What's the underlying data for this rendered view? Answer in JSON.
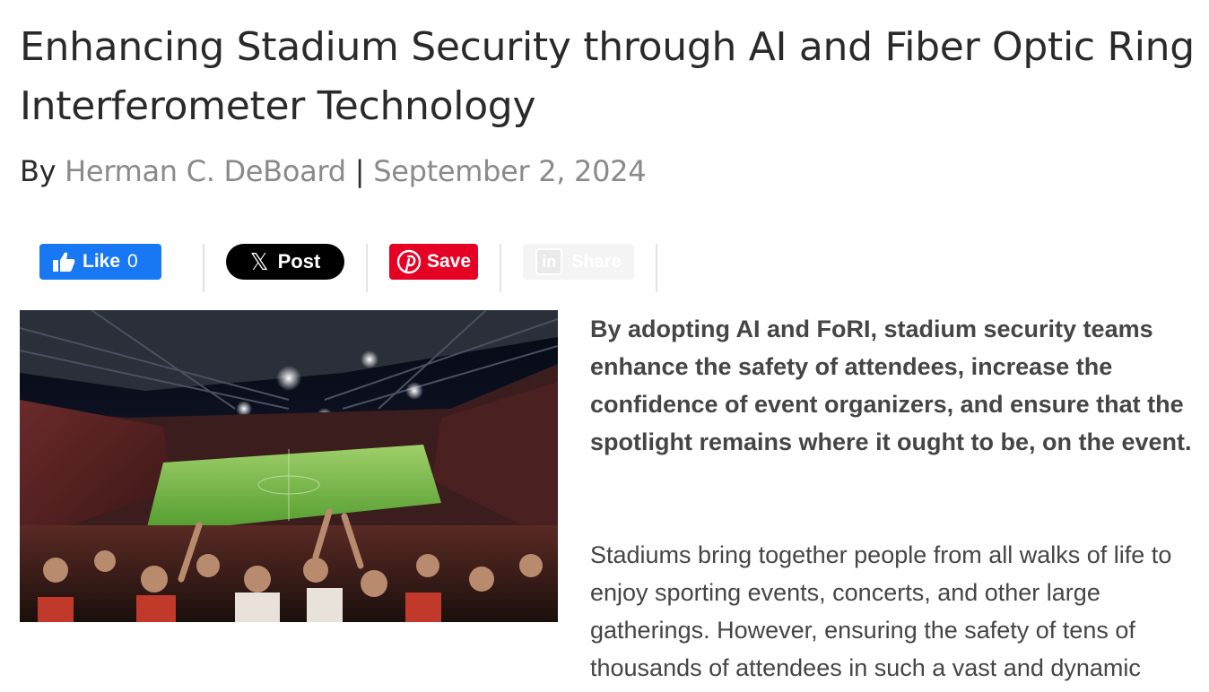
{
  "article": {
    "title": "Enhancing Stadium Security through AI and Fiber Optic Ring Interferometer Technology",
    "by_prefix": "By",
    "author": "Herman C. DeBoard",
    "separator": "|",
    "date": "September 2, 2024"
  },
  "share": {
    "facebook": {
      "label": "Like",
      "count": "0",
      "icon": "thumbs-up-icon",
      "color": "#1877f2"
    },
    "x": {
      "label": "Post",
      "glyph": "𝕏",
      "icon": "x-logo-icon",
      "color": "#000000"
    },
    "pinterest": {
      "label": "Save",
      "icon": "pinterest-logo-icon",
      "color": "#e60023"
    },
    "linkedin": {
      "label": "Share",
      "glyph": "in",
      "icon": "linkedin-logo-icon"
    }
  },
  "image": {
    "subject": "stadium-crowd-photo"
  },
  "content": {
    "lead": "By adopting AI and FoRI, stadium security teams enhance the safety of attendees, increase the confidence of event organizers, and ensure that the spotlight remains where it ought to be, on the event.",
    "paragraph_1": "Stadiums bring together people from all walks of life to enjoy sporting events, concerts, and other large gatherings. However, ensuring the safety of tens of thousands of attendees in such a vast and dynamic"
  }
}
